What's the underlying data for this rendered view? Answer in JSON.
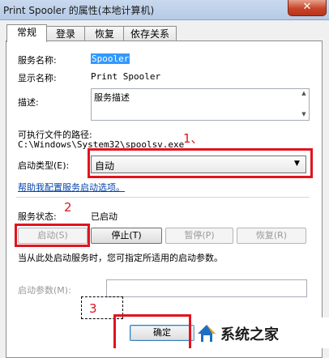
{
  "window": {
    "title": "Print Spooler 的属性(本地计算机)",
    "close_glyph": "✕"
  },
  "tabs": [
    {
      "label": "常规",
      "active": true
    },
    {
      "label": "登录",
      "active": false
    },
    {
      "label": "恢复",
      "active": false
    },
    {
      "label": "依存关系",
      "active": false
    }
  ],
  "general": {
    "service_name_label": "服务名称:",
    "service_name": "Spooler",
    "display_name_label": "显示名称:",
    "display_name": "Print Spooler",
    "description_label": "描述:",
    "description": "服务描述",
    "exe_path_label": "可执行文件的路径:",
    "exe_path": "C:\\Windows\\System32\\spoolsv.exe",
    "startup_type_label": "启动类型(E):",
    "startup_type": "自动",
    "help_link": "帮助我配置服务启动选项。",
    "status_label": "服务状态:",
    "status_value": "已启动",
    "buttons": {
      "start": "启动(S)",
      "stop": "停止(T)",
      "pause": "暂停(P)",
      "resume": "恢复(R)"
    },
    "hint": "当从此处启动服务时，您可指定所适用的启动参数。",
    "start_params_label": "启动参数(M):",
    "start_params_value": ""
  },
  "footer": {
    "ok": "确定"
  },
  "annotations": {
    "n1": "1、",
    "n2": "2",
    "n3": "3"
  },
  "watermark": {
    "text": "系统之家"
  },
  "colors": {
    "annotation_red": "#e0141e",
    "link": "#0645ad"
  }
}
